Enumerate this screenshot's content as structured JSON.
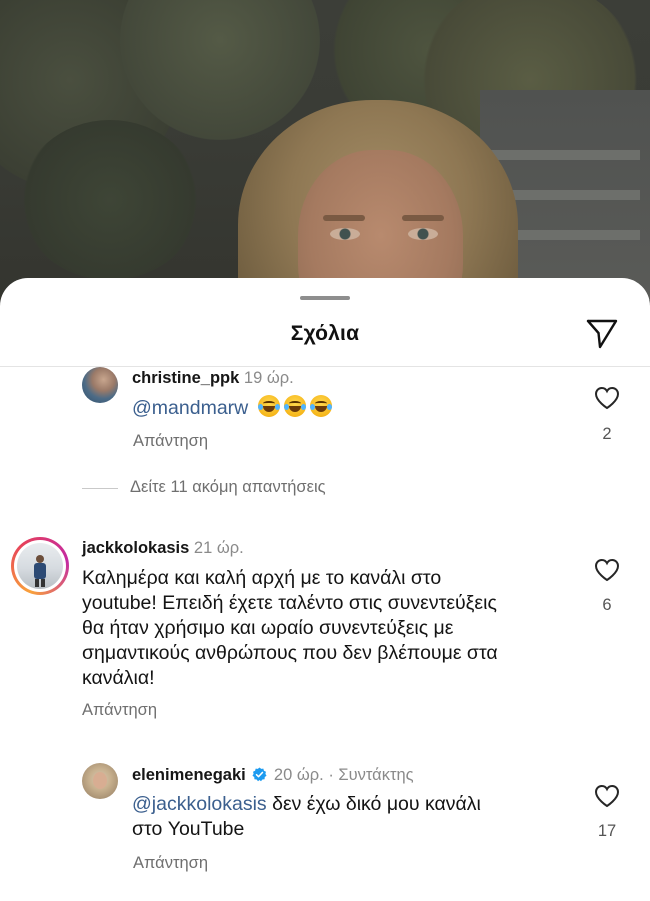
{
  "sheet": {
    "title": "Σχόλια",
    "share_icon": "paper-plane-icon"
  },
  "comments": [
    {
      "username": "christine_ppk",
      "time": "19 ώρ.",
      "mention": "@mandmarw",
      "emoji_count": 3,
      "emoji": "face-with-tears-of-joy",
      "reply_label": "Απάντηση",
      "likes": "2",
      "is_reply": true
    },
    {
      "username": "jackkolokasis",
      "time": "21 ώρ.",
      "text_lines": [
        "Καλημέρα και καλή αρχή με το κανάλι στο",
        "youtube! Επειδή έχετε ταλέντο στις συνεντεύξεις",
        "θα ήταν χρήσιμο και ωραίο συνεντεύξεις με",
        "σημαντικούς ανθρώπους που δεν βλέπουμε στα",
        "κανάλια!"
      ],
      "reply_label": "Απάντηση",
      "likes": "6",
      "has_story_ring": true
    },
    {
      "username": "elenimenegaki",
      "verified": true,
      "time": "20 ώρ.",
      "separator": "·",
      "role": "Συντάκτης",
      "mention": "@jackkolokasis",
      "text_line1_rest": " δεν έχω δικό μου κανάλι",
      "text_line2": "στο YouTube",
      "reply_label": "Απάντηση",
      "likes": "17",
      "is_reply": true
    }
  ],
  "more_replies": {
    "label": "Δείτε 11 ακόμη απαντήσεις"
  },
  "colors": {
    "mention": "#3b5f8e",
    "verified": "#1d9bf0",
    "story_ring_start": "#f9a23b",
    "story_ring_end": "#c32aa3"
  }
}
